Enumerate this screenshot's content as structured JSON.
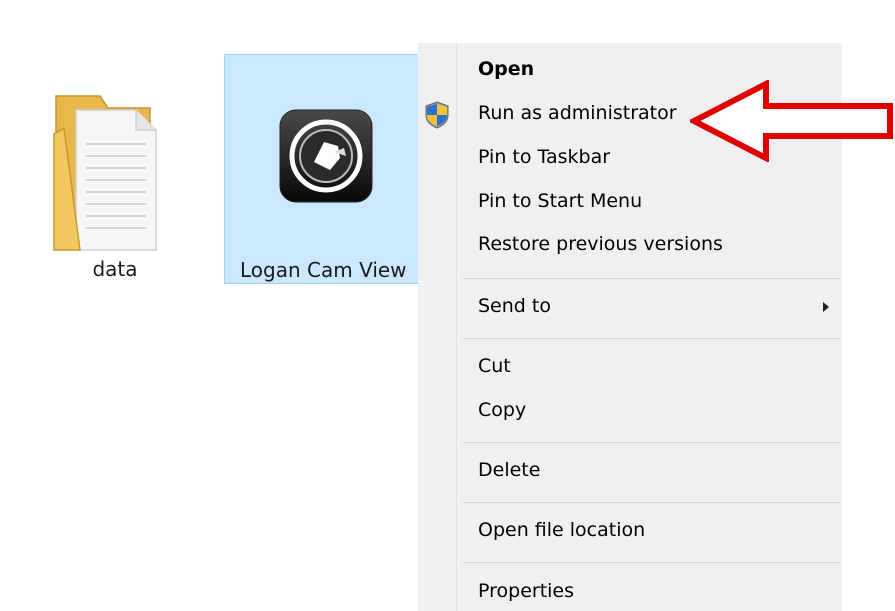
{
  "explorer": {
    "items": [
      {
        "name": "data",
        "type": "folder",
        "selected": false
      },
      {
        "name": "Logan Cam View",
        "type": "application",
        "selected": true
      }
    ]
  },
  "context_menu": {
    "items": [
      {
        "label": "Open",
        "bold": true
      },
      {
        "label": "Run as administrator",
        "icon": "uac-shield-icon"
      },
      {
        "label": "Pin to Taskbar"
      },
      {
        "label": "Pin to Start Menu"
      },
      {
        "label": "Restore previous versions"
      },
      {
        "label": "Send to",
        "submenu": true
      },
      {
        "label": "Cut"
      },
      {
        "label": "Copy"
      },
      {
        "label": "Delete"
      },
      {
        "label": "Open file location"
      },
      {
        "label": "Properties"
      }
    ]
  },
  "colors": {
    "selection_fill": "#cce8ff",
    "selection_border": "#99d1ff",
    "menu_background": "#f0f0f0",
    "annotation_arrow": "#e00000"
  }
}
